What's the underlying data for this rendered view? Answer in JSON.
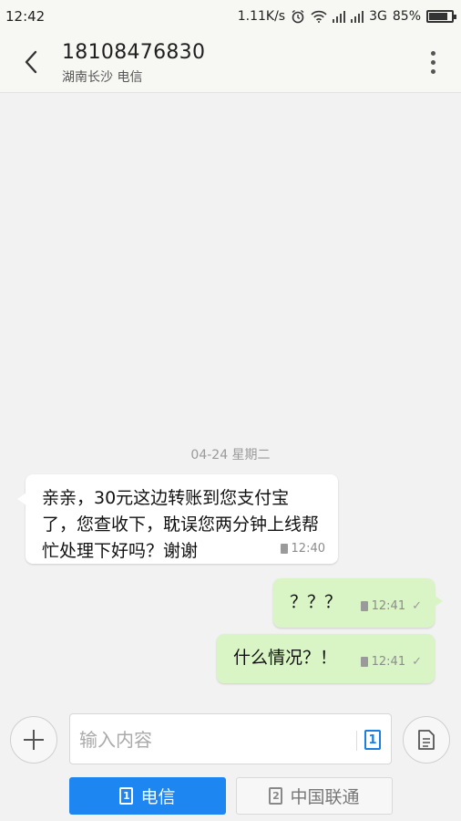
{
  "status_bar": {
    "time": "12:42",
    "speed": "1.11K/s",
    "network": "3G",
    "battery": "85%",
    "battery_level": 0.85
  },
  "header": {
    "title": "18108476830",
    "subtitle": "湖南长沙 电信"
  },
  "conversation": {
    "date": "04-24  星期二",
    "messages": [
      {
        "direction": "incoming",
        "text": "亲亲，30元这边转账到您支付宝了，您查收下，耽误您两分钟上线帮忙处理下好吗？谢谢",
        "time": "12:40"
      },
      {
        "direction": "outgoing",
        "text": "？？？",
        "time": "12:41"
      },
      {
        "direction": "outgoing",
        "text": "什么情况？！",
        "time": "12:41"
      }
    ]
  },
  "compose": {
    "placeholder": "输入内容",
    "sim_indicator": "1"
  },
  "send_buttons": [
    {
      "sim": "1",
      "label": "电信",
      "active": true
    },
    {
      "sim": "2",
      "label": "中国联通",
      "active": false
    }
  ],
  "colors": {
    "accent": "#1e86f0",
    "outgoing_bubble": "#d9f5c5",
    "incoming_bubble": "#ffffff",
    "background": "#f2f2f2"
  }
}
